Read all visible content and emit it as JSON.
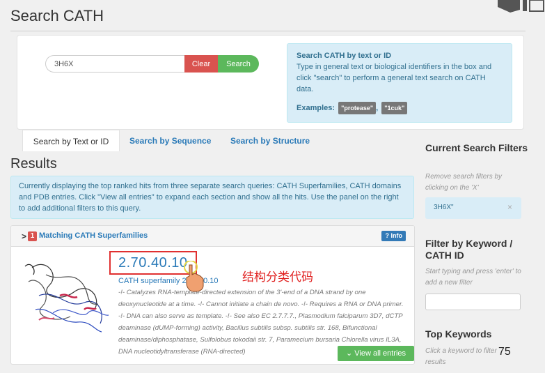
{
  "page": {
    "title": "Search CATH"
  },
  "search": {
    "value": "3H6X",
    "clear_label": "Clear",
    "search_label": "Search"
  },
  "help": {
    "title": "Search CATH by text or ID",
    "body": "Type in general text or biological identifiers in the box and click \"search\" to perform a general text search on CATH data.",
    "examples_label": "Examples:",
    "examples": [
      "\"protease\"",
      "\"1cuk\""
    ]
  },
  "tabs": [
    {
      "label": "Search by Text or ID",
      "active": true
    },
    {
      "label": "Search by Sequence",
      "active": false
    },
    {
      "label": "Search by Structure",
      "active": false
    }
  ],
  "results": {
    "heading": "Results",
    "info": "Currently displaying the top ranked hits from three separate search queries: CATH Superfamilies, CATH domains and PDB entries. Click \"View all entries\" to expand each section and show all the hits. Use the panel on the right to add additional filters to this query."
  },
  "superfamilies": {
    "caret": ">",
    "count": "1",
    "title": "Matching CATH Superfamilies",
    "info_label": "Info",
    "hit": {
      "id": "2.70.40.10",
      "subtitle": "CATH superfamily 2.70.40.10",
      "description": "-!- Catalyzes RNA-template-directed extension of the 3'-end of a DNA strand by one deoxynucleotide at a time. -!- Cannot initiate a chain de novo. -!- Requires a RNA or DNA primer. -!- DNA can also serve as template. -!- See also EC 2.7.7.7., Plasmodium falciparum 3D7, dCTP deaminase (dUMP-forming) activity, Bacillus subtilis subsp. subtilis str. 168, Bifunctional deaminase/diphosphatase, Sulfolobus tokodaii str. 7, Paramecium bursaria Chlorella virus IL3A, DNA nucleotidyltransferase (RNA-directed)"
    },
    "view_all_label": "View all entries"
  },
  "annotation": "结构分类代码",
  "sidebar": {
    "current_filters_title": "Current Search Filters",
    "current_filters_note": "Remove search filters by clicking on the 'X'",
    "filter_chip": "3H6X\"",
    "filter_chip_close": "×",
    "keyword_title": "Filter by Keyword / CATH ID",
    "keyword_note": "Start typing and press 'enter' to add a new filter",
    "top_keywords_title": "Top Keywords",
    "top_keywords_note": "Click a keyword to filter results"
  },
  "slide_number": "75",
  "colors": {
    "link": "#2a7ab8",
    "danger": "#d9534f",
    "success": "#5cb85c",
    "info_bg": "#d9edf7",
    "annotation_red": "#e0201f"
  }
}
